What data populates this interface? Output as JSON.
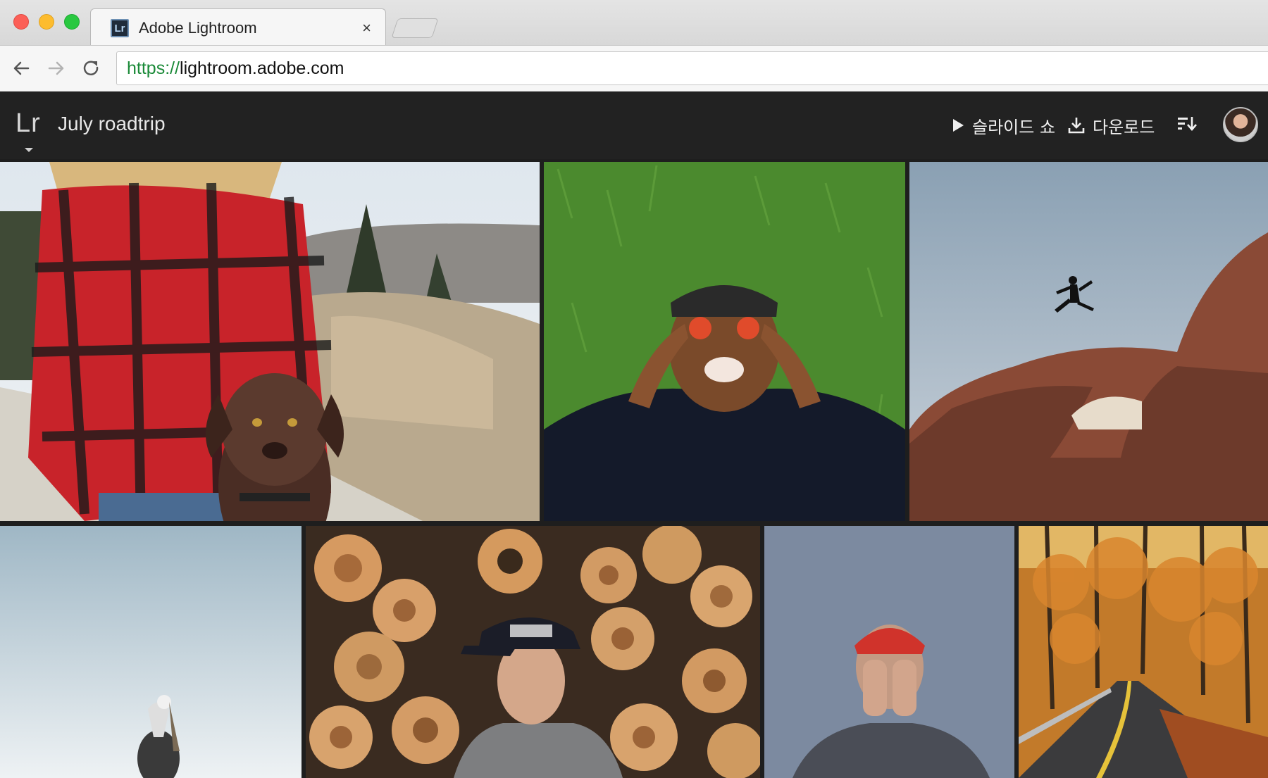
{
  "browser": {
    "tab_title": "Adobe Lightroom",
    "tab_favicon": "Lr",
    "url_scheme": "https://",
    "url_host": "lightroom.adobe.com"
  },
  "header": {
    "logo": "Lr",
    "album_title": "July roadtrip",
    "slideshow_label": "슬라이드 쇼",
    "download_label": "다운로드"
  },
  "icons": {
    "back": "arrow-left-icon",
    "forward": "arrow-right-icon",
    "reload": "reload-icon",
    "close": "close-icon",
    "play": "play-icon",
    "download": "download-icon",
    "sort": "sort-icon"
  },
  "colors": {
    "header_bg": "#222222",
    "url_scheme": "#1a8a38"
  },
  "photos": [
    "woman-with-puppy",
    "man-on-grass",
    "jump-over-arch",
    "pelican",
    "man-with-logs",
    "man-covering-face",
    "autumn-road"
  ]
}
